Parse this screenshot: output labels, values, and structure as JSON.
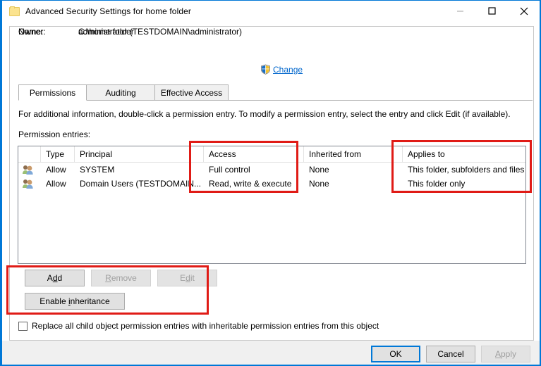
{
  "window": {
    "title": "Advanced Security Settings for home folder",
    "icon": "folder-icon",
    "controls": {
      "minimize": "minimize-icon",
      "maximize": "maximize-icon",
      "close": "close-icon"
    },
    "accent_color": "#0078d7"
  },
  "header": {
    "name_label": "Name:",
    "name_value": "C:\\home folder",
    "owner_label": "Owner:",
    "owner_value": "administrator (TESTDOMAIN\\administrator)",
    "change_link": "Change",
    "change_icon": "uac-shield-icon"
  },
  "tabs": [
    {
      "label": "Permissions",
      "active": true
    },
    {
      "label": "Auditing",
      "active": false
    },
    {
      "label": "Effective Access",
      "active": false
    }
  ],
  "permissions_tab": {
    "instructions": "For additional information, double-click a permission entry. To modify a permission entry, select the entry and click Edit (if available).",
    "entries_label": "Permission entries:",
    "columns": [
      "Type",
      "Principal",
      "Access",
      "Inherited from",
      "Applies to"
    ],
    "rows": [
      {
        "icon": "group-icon",
        "type": "Allow",
        "principal": "SYSTEM",
        "access": "Full control",
        "inherited_from": "None",
        "applies_to": "This folder, subfolders and files"
      },
      {
        "icon": "group-icon",
        "type": "Allow",
        "principal": "Domain Users (TESTDOMAIN...",
        "access": "Read, write & execute",
        "inherited_from": "None",
        "applies_to": "This folder only"
      }
    ],
    "buttons": {
      "add": {
        "label": "Add",
        "accel": "d",
        "disabled": false
      },
      "remove": {
        "label": "Remove",
        "accel": "R",
        "disabled": true
      },
      "edit": {
        "label": "Edit",
        "accel": "d",
        "disabled": true
      },
      "enable_inheritance": {
        "label": "Enable inheritance",
        "accel": "i",
        "disabled": false
      }
    },
    "replace_checkbox": {
      "label": "Replace all child object permission entries with inheritable permission entries from this object",
      "checked": false
    }
  },
  "footer": {
    "ok": "OK",
    "cancel": "Cancel",
    "apply": "Apply"
  },
  "annotations": {
    "color": "#e01b16",
    "boxes": [
      "access-column",
      "applies-to-column",
      "permission-action-buttons"
    ]
  }
}
